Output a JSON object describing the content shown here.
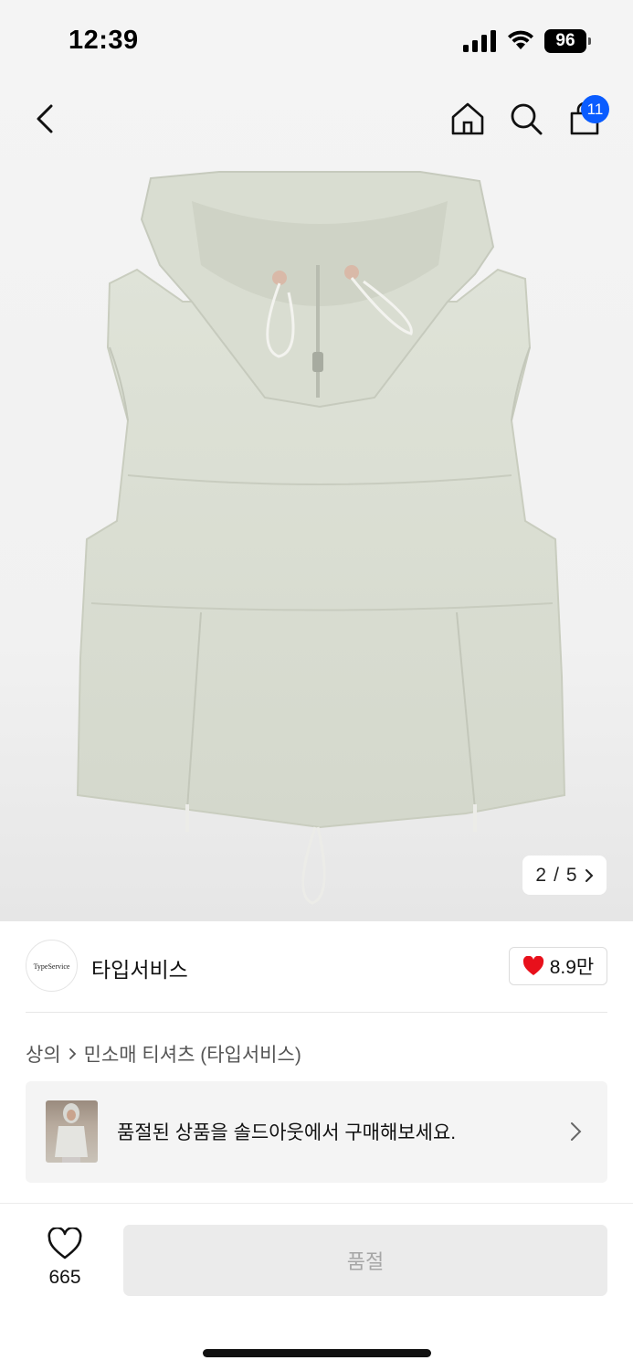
{
  "status_bar": {
    "time": "12:39",
    "battery": "96"
  },
  "nav": {
    "cart_count": "11"
  },
  "gallery": {
    "current": "2",
    "total": "5",
    "separator": "/"
  },
  "brand": {
    "logo_text": "TypeService",
    "name": "타입서비스",
    "likes": "8.9만"
  },
  "breadcrumb": {
    "category": "상의",
    "subcategory": "민소매 티셔츠 (타입서비스)"
  },
  "soldout_banner": {
    "text": "품절된 상품을 솔드아웃에서 구매해보세요."
  },
  "bottom_bar": {
    "wish_count": "665",
    "buy_label": "품절"
  },
  "colors": {
    "badge": "#0a5cff",
    "heart": "#e8101b",
    "button_bg": "#ebebeb"
  }
}
